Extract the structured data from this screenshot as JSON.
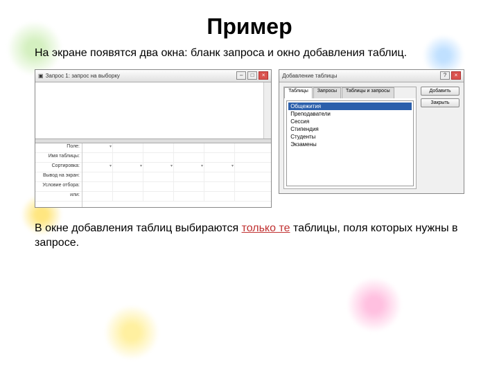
{
  "title": "Пример",
  "intro": "На экране появятся два окна: бланк запроса и окно добавления таблиц.",
  "outro_pre": "В окне добавления таблиц выбираются ",
  "outro_hl": "только те",
  "outro_post": " таблицы, поля которых нужны в запросе.",
  "query_window": {
    "title": "Запрос 1: запрос на выборку",
    "row_labels": [
      "Поле:",
      "Имя таблицы:",
      "Сортировка:",
      "Вывод на экран:",
      "Условие отбора:",
      "или:"
    ]
  },
  "add_dialog": {
    "title": "Добавление таблицы",
    "tabs": [
      "Таблицы",
      "Запросы",
      "Таблицы и запросы"
    ],
    "items": [
      "Общежития",
      "Преподаватели",
      "Сессия",
      "Стипендия",
      "Студенты",
      "Экзамены"
    ],
    "btn_add": "Добавить",
    "btn_close": "Закрыть"
  }
}
